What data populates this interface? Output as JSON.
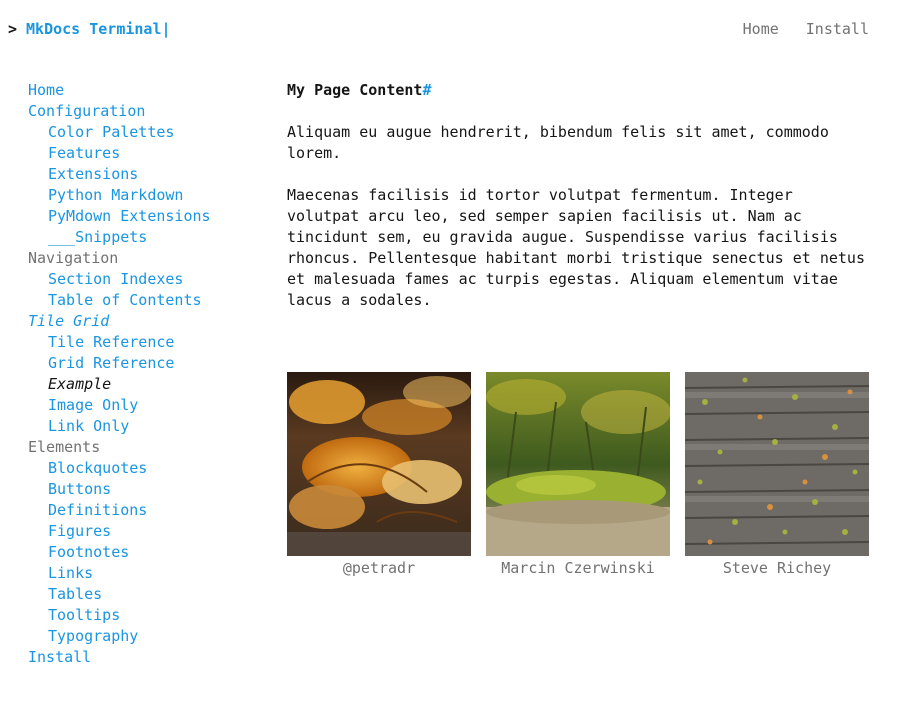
{
  "header": {
    "prompt": ">",
    "site_title": "MkDocs Terminal",
    "cursor": "|",
    "nav": [
      {
        "label": "Home"
      },
      {
        "label": "Install"
      }
    ]
  },
  "sidebar": {
    "items": [
      {
        "label": "Home"
      },
      {
        "label": "Configuration"
      },
      {
        "label": "Color Palettes"
      },
      {
        "label": "Features"
      },
      {
        "label": "Extensions"
      },
      {
        "label": "Python Markdown"
      },
      {
        "label": "PyMdown Extensions"
      },
      {
        "label": "___Snippets"
      },
      {
        "label": "Navigation"
      },
      {
        "label": "Section Indexes"
      },
      {
        "label": "Table of Contents"
      },
      {
        "label": "Tile Grid"
      },
      {
        "label": "Tile Reference"
      },
      {
        "label": "Grid Reference"
      },
      {
        "label": "Example"
      },
      {
        "label": "Image Only"
      },
      {
        "label": "Link Only"
      },
      {
        "label": "Elements"
      },
      {
        "label": "Blockquotes"
      },
      {
        "label": "Buttons"
      },
      {
        "label": "Definitions"
      },
      {
        "label": "Figures"
      },
      {
        "label": "Footnotes"
      },
      {
        "label": "Links"
      },
      {
        "label": "Tables"
      },
      {
        "label": "Tooltips"
      },
      {
        "label": "Typography"
      },
      {
        "label": "Install"
      }
    ]
  },
  "main": {
    "heading": "My Page Content",
    "heading_anchor": "#",
    "paragraph1": "Aliquam eu augue hendrerit, bibendum felis sit amet, commodo lorem.",
    "paragraph2": "Maecenas facilisis id tortor volutpat fermentum. Integer volutpat arcu leo, sed semper sapien facilisis ut. Nam ac tincidunt sem, eu gravida augue. Suspendisse varius facilisis rhoncus. Pellentesque habitant morbi tristique senectus et netus et malesuada fames ac turpis egestas. Aliquam elementum vitae lacus a sodales.",
    "tiles": [
      {
        "caption": "@petradr"
      },
      {
        "caption": "Marcin Czerwinski"
      },
      {
        "caption": "Steve Richey"
      }
    ]
  },
  "colors": {
    "link": "#1a95e0",
    "muted": "#727272",
    "text": "#151515",
    "background": "#ffffff"
  }
}
